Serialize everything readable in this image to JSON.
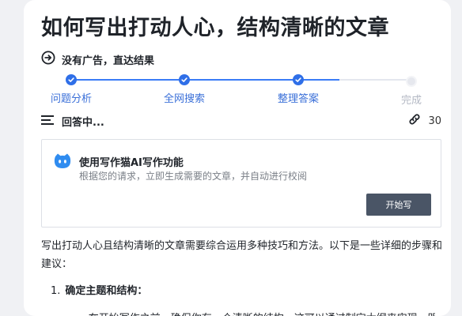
{
  "article": {
    "title": "如何写出打动人心，结构清晰的文章"
  },
  "tagline": {
    "icon": "arrow-right-circle-icon",
    "text": "没有广告，直达结果"
  },
  "steps": [
    {
      "label": "问题分析",
      "status": "done"
    },
    {
      "label": "全网搜索",
      "status": "done"
    },
    {
      "label": "整理答案",
      "status": "done"
    },
    {
      "label": "完成",
      "status": "pending"
    }
  ],
  "answer_bar": {
    "label": "回答中...",
    "link_count": "30"
  },
  "promo": {
    "title": "使用写作猫AI写作功能",
    "subtitle": "根据您的请求，立即生成需要的文章，并自动进行校阅",
    "button_label": "开始写"
  },
  "content": {
    "intro": "写出打动人心且结构清晰的文章需要综合运用多种技巧和方法。以下是一些详细的步骤和建议：",
    "items": [
      {
        "number": "1.",
        "title": "确定主题和结构："
      }
    ],
    "partial_line": "• 在开始写作之前，确保你有一个清晰的结构，这可以通过制定大纲来实现，明确每"
  },
  "colors": {
    "accent": "#2f6fe8",
    "button": "#4a5566",
    "pending": "#b4b9c4"
  }
}
